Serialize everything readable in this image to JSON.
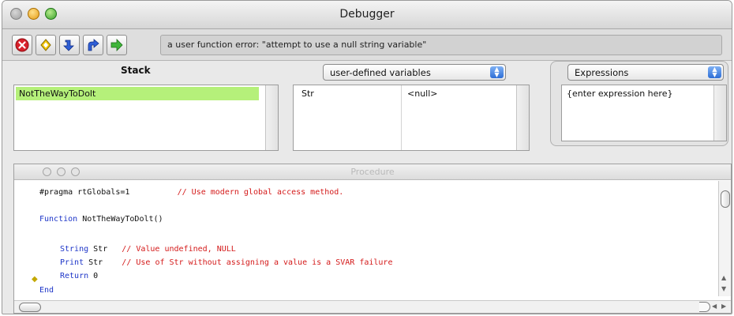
{
  "window": {
    "title": "Debugger"
  },
  "toolbar": {
    "buttons": [
      {
        "name": "stop",
        "icon": "stop-icon",
        "color": "#d8202a"
      },
      {
        "name": "run",
        "icon": "diamond-icon",
        "color": "#f5c800"
      },
      {
        "name": "step-into",
        "icon": "step-into-icon",
        "color": "#2f5fd6"
      },
      {
        "name": "step-out",
        "icon": "step-out-icon",
        "color": "#2f5fd6"
      },
      {
        "name": "step-over",
        "icon": "step-over-icon",
        "color": "#3fb53a"
      }
    ],
    "message": "a user function error: \"attempt to use a null string variable\""
  },
  "stack": {
    "title": "Stack",
    "items": [
      {
        "label": "NotTheWayToDolt",
        "selected": true
      }
    ],
    "highlight_color": "#b5f07a"
  },
  "variables": {
    "selector": "user-defined variables",
    "rows": [
      {
        "name": "Str",
        "value": "<null>"
      }
    ]
  },
  "expressions": {
    "selector": "Expressions",
    "placeholder": "{enter expression here}"
  },
  "procedure": {
    "title": "Procedure",
    "lines": [
      {
        "code": "#pragma rtGlobals=1",
        "comment": "// Use modern global access method."
      },
      {
        "keyword": "Function",
        "code": "NotTheWayToDolt()"
      },
      {
        "keyword": "String",
        "code": "Str",
        "comment": "// Value undefined, NULL"
      },
      {
        "keyword": "Print",
        "code": "Str",
        "comment": "// Use of Str without assigning a value is a SVAR failure"
      },
      {
        "keyword": "Return",
        "code": "0"
      },
      {
        "keyword": "End"
      }
    ],
    "keyword_color": "#1d35c8",
    "comment_color": "#d41a1a"
  }
}
